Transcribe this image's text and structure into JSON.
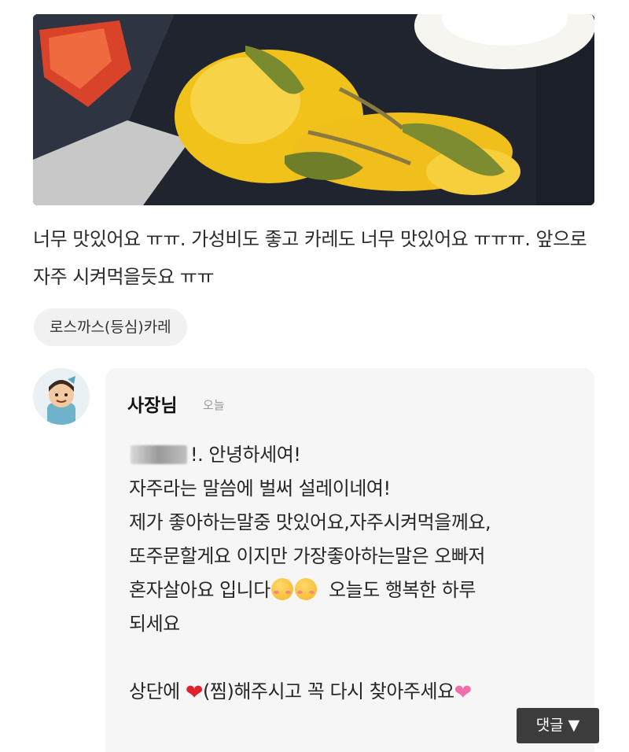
{
  "review": {
    "photo_alt": "",
    "text": "너무 맛있어요 ㅠㅠ. 가성비도 좋고 카레도 너무 맛있어요 ㅠㅠㅠ. 앞으로 자주 시켜먹을듯요 ㅠㅠ",
    "menu_tag": "로스까스(등심)카레"
  },
  "reply": {
    "author": "사장님",
    "time": "오늘",
    "line1": "!. 안녕하세여!",
    "line2": "자주라는 말씀에 벌써 설레이네여!",
    "line3": "제가 좋아하는말중 맛있어요,자주시켜먹을께요,",
    "line4": "또주문할게요 이지만 가장좋아하는말은 오빠저",
    "line5a": "혼자살아요 입니다",
    "line5b": "오늘도 행복한 하루",
    "line6": "되세요",
    "line7a": "상단에",
    "line7b": "(찜)해주시고 꼭 다시 찾아주세요"
  },
  "comment_button": {
    "label": "댓글 ▼"
  },
  "icons": {
    "heart_red": "red-heart-icon",
    "heart_pink": "sparkling-heart-icon",
    "blush": "smiling-face-icon"
  }
}
